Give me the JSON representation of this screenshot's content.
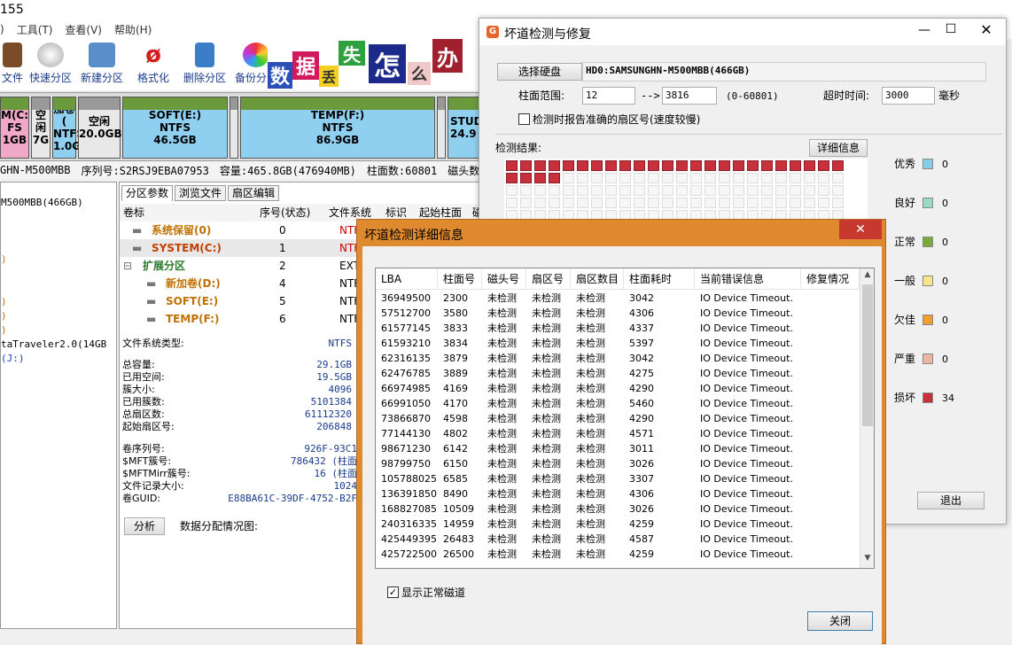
{
  "bg_app": {
    "title": "155",
    "menu": [
      "工具(T)",
      "查看(V)",
      "帮助(H)"
    ],
    "menu_prefix": ")",
    "toolbar": [
      "文件",
      "快速分区",
      "新建分区",
      "格式化",
      "删除分区",
      "备份分区"
    ],
    "banner": [
      "数",
      "据",
      "丢",
      "失",
      "怎",
      "么",
      "办"
    ],
    "partitions": [
      {
        "l1": "M(C:",
        "l2": "FS",
        "l3": "1GB"
      },
      {
        "l1": "空闲",
        "l2": "",
        "l3": "7G"
      },
      {
        "l1": "加卷(",
        "l2": "NTFS",
        "l3": "1.0G"
      },
      {
        "l1": "空闲",
        "l2": "",
        "l3": "20.0GB"
      },
      {
        "l1": "SOFT(E:)",
        "l2": "NTFS",
        "l3": "46.5GB"
      },
      {
        "l1": "TEMP(F:)",
        "l2": "NTFS",
        "l3": "86.9GB"
      },
      {
        "l1": "STUD",
        "l2": "",
        "l3": "24.9"
      }
    ],
    "disk_info": [
      "GHN-M500MBB",
      "序列号:S2RSJ9EBA07953",
      "容量:465.8GB(476940MB)",
      "柱面数:60801",
      "磁头数:255",
      "每道"
    ],
    "tree": [
      "M500MBB(466GB)",
      ")",
      ")",
      ")",
      ")",
      "taTraveler2.0(14GB",
      "(J:)"
    ],
    "tabs": [
      "分区参数",
      "浏览文件",
      "扇区编辑"
    ],
    "vol_headers": [
      "卷标",
      "序号(状态)",
      "文件系统",
      "标识",
      "起始柱面",
      "磁"
    ],
    "volumes": [
      {
        "name": "系统保留(0)",
        "idx": "0",
        "fs": "NTF"
      },
      {
        "name": "SYSTEM(C:)",
        "idx": "1",
        "fs": "NTF"
      },
      {
        "name": "扩展分区",
        "idx": "2",
        "fs": "EXTE"
      },
      {
        "name": "新加卷(D:)",
        "idx": "4",
        "fs": "NTF"
      },
      {
        "name": "SOFT(E:)",
        "idx": "5",
        "fs": "NTF"
      },
      {
        "name": "TEMP(F:)",
        "idx": "6",
        "fs": "NTF"
      }
    ],
    "fs_type_label": "文件系统类型:",
    "fs_type_value": "NTFS",
    "stats": [
      {
        "k": "总容量:",
        "v": "29.1GB"
      },
      {
        "k": "已用空间:",
        "v": "19.5GB"
      },
      {
        "k": "簇大小:",
        "v": "4096"
      },
      {
        "k": "已用簇数:",
        "v": "5101384"
      },
      {
        "k": "总扇区数:",
        "v": "61112320"
      },
      {
        "k": "起始扇区号:",
        "v": "206848"
      }
    ],
    "stats2": [
      {
        "k": "卷序列号:",
        "v": "926F-93C1"
      },
      {
        "k": "$MFT簇号:",
        "v": "786432 (柱面"
      },
      {
        "k": "$MFTMirr簇号:",
        "v": "16 (柱面"
      },
      {
        "k": "文件记录大小:",
        "v": "1024"
      },
      {
        "k": "卷GUID:",
        "v": "E88BA61C-39DF-4752-B2F"
      }
    ],
    "analyze_btn": "分析",
    "dist_label": "数据分配情况图:"
  },
  "badsector": {
    "title": "坏道检测与修复",
    "select_disk": "选择硬盘",
    "disk_name": "HD0:SAMSUNGHN-M500MBB(466GB)",
    "cyl_range_label": "柱面范围:",
    "cyl_from": "12",
    "arrow": "-->",
    "cyl_to": "3816",
    "cyl_hint": "(0-60801)",
    "timeout_label": "超时时间:",
    "timeout": "3000",
    "timeout_unit": "毫秒",
    "report_checkbox": "检测时报告准确的扇区号(速度较慢)",
    "result_label": "检测结果:",
    "detail_btn": "详细信息",
    "exit_btn": "退出",
    "legend": [
      {
        "name": "优秀",
        "count": "0",
        "color": "#87cde8"
      },
      {
        "name": "良好",
        "count": "0",
        "color": "#9ad8c8"
      },
      {
        "name": "正常",
        "count": "0",
        "color": "#7da83c"
      },
      {
        "name": "一般",
        "count": "0",
        "color": "#f7e68a"
      },
      {
        "name": "欠佳",
        "count": "0",
        "color": "#f0a030"
      },
      {
        "name": "严重",
        "count": "0",
        "color": "#e8b8a0"
      },
      {
        "name": "损坏",
        "count": "34",
        "color": "#c8303c"
      }
    ],
    "damaged_blocks": 28
  },
  "detail": {
    "title": "坏道检测详细信息",
    "columns": [
      "LBA",
      "柱面号",
      "磁头号",
      "扇区号",
      "扇区数目",
      "柱面耗时",
      "当前错误信息",
      "修复情况"
    ],
    "rows": [
      [
        "36949500",
        "2300",
        "未检测",
        "未检测",
        "未检测",
        "3042",
        "IO Device Timeout."
      ],
      [
        "57512700",
        "3580",
        "未检测",
        "未检测",
        "未检测",
        "4306",
        "IO Device Timeout."
      ],
      [
        "61577145",
        "3833",
        "未检测",
        "未检测",
        "未检测",
        "4337",
        "IO Device Timeout."
      ],
      [
        "61593210",
        "3834",
        "未检测",
        "未检测",
        "未检测",
        "5397",
        "IO Device Timeout."
      ],
      [
        "62316135",
        "3879",
        "未检测",
        "未检测",
        "未检测",
        "3042",
        "IO Device Timeout."
      ],
      [
        "62476785",
        "3889",
        "未检测",
        "未检测",
        "未检测",
        "4275",
        "IO Device Timeout."
      ],
      [
        "66974985",
        "4169",
        "未检测",
        "未检测",
        "未检测",
        "4290",
        "IO Device Timeout."
      ],
      [
        "66991050",
        "4170",
        "未检测",
        "未检测",
        "未检测",
        "5460",
        "IO Device Timeout."
      ],
      [
        "73866870",
        "4598",
        "未检测",
        "未检测",
        "未检测",
        "4290",
        "IO Device Timeout."
      ],
      [
        "77144130",
        "4802",
        "未检测",
        "未检测",
        "未检测",
        "4571",
        "IO Device Timeout."
      ],
      [
        "98671230",
        "6142",
        "未检测",
        "未检测",
        "未检测",
        "3011",
        "IO Device Timeout."
      ],
      [
        "98799750",
        "6150",
        "未检测",
        "未检测",
        "未检测",
        "3026",
        "IO Device Timeout."
      ],
      [
        "105788025",
        "6585",
        "未检测",
        "未检测",
        "未检测",
        "3307",
        "IO Device Timeout."
      ],
      [
        "136391850",
        "8490",
        "未检测",
        "未检测",
        "未检测",
        "4306",
        "IO Device Timeout."
      ],
      [
        "168827085",
        "10509",
        "未检测",
        "未检测",
        "未检测",
        "3026",
        "IO Device Timeout."
      ],
      [
        "240316335",
        "14959",
        "未检测",
        "未检测",
        "未检测",
        "4259",
        "IO Device Timeout."
      ],
      [
        "425449395",
        "26483",
        "未检测",
        "未检测",
        "未检测",
        "4587",
        "IO Device Timeout."
      ],
      [
        "425722500",
        "26500",
        "未检测",
        "未检测",
        "未检测",
        "4259",
        "IO Device Timeout."
      ]
    ],
    "show_normal": "显示正常磁道",
    "close_btn": "关闭"
  }
}
